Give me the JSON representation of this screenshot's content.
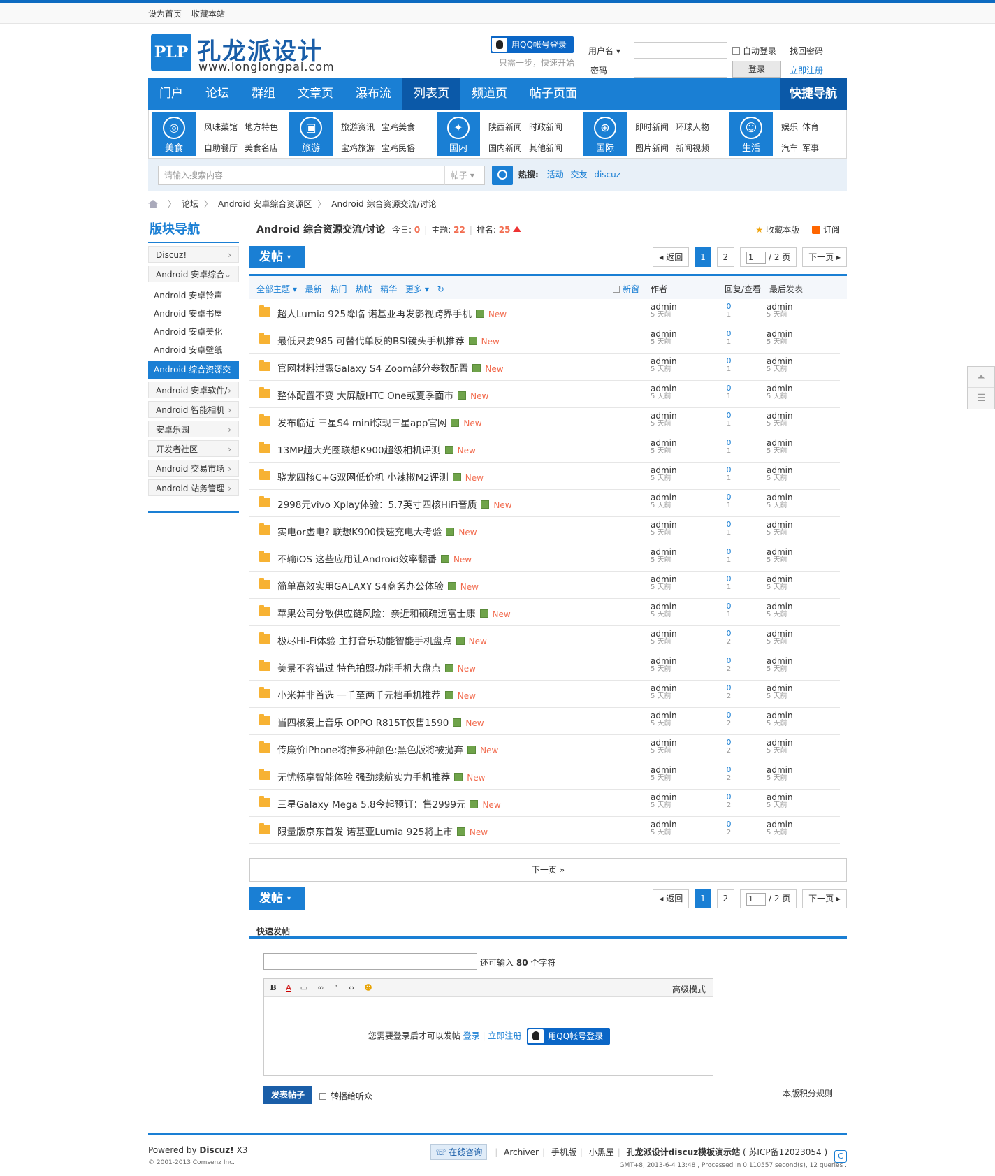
{
  "topbar": {
    "links": [
      "设为首页",
      "收藏本站"
    ]
  },
  "logo": {
    "mark": "PLP",
    "cn": "孔龙派设计",
    "url": "www.longlongpai.com"
  },
  "qq": {
    "btn": "用QQ帐号登录",
    "sub": "只需一步，快速开始"
  },
  "login": {
    "user_label": "用户名",
    "pass_label": "密码",
    "auto": "自动登录",
    "find": "找回密码",
    "register": "立即注册",
    "login_btn": "登录"
  },
  "nav": {
    "items": [
      "门户",
      "论坛",
      "群组",
      "文章页",
      "瀑布流",
      "列表页",
      "频道页",
      "帖子页面"
    ],
    "active": 5,
    "quick": "快捷导航"
  },
  "cats": [
    {
      "title": "美食",
      "links": [
        "风味菜馆",
        "地方特色",
        "自助餐厅",
        "美食名店"
      ]
    },
    {
      "title": "旅游",
      "links": [
        "旅游资讯",
        "宝鸡美食",
        "宝鸡旅游",
        "宝鸡民俗"
      ]
    },
    {
      "title": "国内",
      "links": [
        "陕西新闻",
        "时政新闻",
        "国内新闻",
        "其他新闻"
      ]
    },
    {
      "title": "国际",
      "links": [
        "即时新闻",
        "环球人物",
        "图片新闻",
        "新闻视频"
      ]
    },
    {
      "title": "生活",
      "links": [
        "娱乐",
        "体育",
        "汽车",
        "军事"
      ]
    }
  ],
  "search": {
    "placeholder": "请输入搜索内容",
    "type": "帖子",
    "hot_label": "热搜:",
    "hot": [
      "活动",
      "交友",
      "discuz"
    ]
  },
  "crumb": [
    "论坛",
    "Android 安卓综合资源区",
    "Android 综合资源交流/讨论"
  ],
  "side": {
    "title": "版块导航",
    "items": [
      "Discuz!",
      "Android 安卓综合"
    ],
    "subs": [
      "Android 安卓铃声",
      "Android 安卓书屋",
      "Android 安卓美化",
      "Android 安卓壁纸"
    ],
    "current": "Android 综合资源交",
    "items2": [
      "Android 安卓软件/",
      "Android 智能相机",
      "安卓乐园",
      "开发者社区",
      "Android 交易市场",
      "Android 站务管理"
    ]
  },
  "forum": {
    "name": "Android 综合资源交流/讨论",
    "today_label": "今日:",
    "today": "0",
    "topics_label": "主题:",
    "topics": "22",
    "rank_label": "排名:",
    "rank": "25",
    "fav": "收藏本版",
    "sub": "订阅"
  },
  "toolbar": {
    "post": "发帖",
    "back": "返回",
    "pages": [
      "1",
      "2"
    ],
    "page_input": "1",
    "total": "/ 2 页",
    "next": "下一页"
  },
  "listhead": {
    "tabs": [
      "全部主题 ▾",
      "最新",
      "热门",
      "热帖",
      "精华",
      "更多 ▾",
      "↻"
    ],
    "new": "新窗",
    "author": "作者",
    "replies": "回复/查看",
    "last": "最后发表"
  },
  "threads": [
    {
      "title": "超人Lumia 925降临 诺基亚再发影视跨界手机",
      "r": "0",
      "v": "1"
    },
    {
      "title": "最低只要985 可替代单反的BSI镜头手机推荐",
      "r": "0",
      "v": "1"
    },
    {
      "title": "官网材料泄露Galaxy S4 Zoom部分参数配置",
      "r": "0",
      "v": "1"
    },
    {
      "title": "整体配置不变 大屏版HTC One或夏季面市",
      "r": "0",
      "v": "1"
    },
    {
      "title": "发布临近 三星S4 mini惊现三星app官网",
      "r": "0",
      "v": "1"
    },
    {
      "title": "13MP超大光圈联想K900超级相机评测",
      "r": "0",
      "v": "1"
    },
    {
      "title": "骁龙四核C+G双网低价机 小辣椒M2评测",
      "r": "0",
      "v": "1"
    },
    {
      "title": "2998元vivo Xplay体验：5.7英寸四核HiFi音质",
      "r": "0",
      "v": "1"
    },
    {
      "title": "实电or虚电? 联想K900快速充电大考验",
      "r": "0",
      "v": "1"
    },
    {
      "title": "不输iOS 这些应用让Android效率翻番",
      "r": "0",
      "v": "1"
    },
    {
      "title": "简单高效实用GALAXY S4商务办公体验",
      "r": "0",
      "v": "1"
    },
    {
      "title": "苹果公司分散供应链风险：亲近和硕疏远富士康",
      "r": "0",
      "v": "1"
    },
    {
      "title": "极尽Hi-Fi体验 主打音乐功能智能手机盘点",
      "r": "0",
      "v": "2"
    },
    {
      "title": "美景不容错过 特色拍照功能手机大盘点",
      "r": "0",
      "v": "2"
    },
    {
      "title": "小米并非首选 一千至两千元档手机推荐",
      "r": "0",
      "v": "2"
    },
    {
      "title": "当四核爱上音乐 OPPO R815T仅售1590",
      "r": "0",
      "v": "2"
    },
    {
      "title": "传廉价iPhone将推多种颜色:黑色版将被抛弃",
      "r": "0",
      "v": "2"
    },
    {
      "title": "无忧畅享智能体验 强劲续航实力手机推荐",
      "r": "0",
      "v": "2"
    },
    {
      "title": "三星Galaxy Mega 5.8今起预订：售2999元",
      "r": "0",
      "v": "2"
    },
    {
      "title": "限量版京东首发 诺基亚Lumia 925将上市",
      "r": "0",
      "v": "2"
    }
  ],
  "thread_common": {
    "author": "admin",
    "time": "5 天前",
    "new": "New"
  },
  "nextbar": "下一页 »",
  "quick": {
    "title": "快速发帖",
    "remain": "还可输入",
    "remain_num": "80",
    "remain_unit": "个字符",
    "adv": "高级模式",
    "need_login": "您需要登录后才可以发帖",
    "login": "登录",
    "register": "立即注册",
    "submit": "发表帖子",
    "rebroadcast": "转播给听众",
    "rules": "本版积分规则"
  },
  "footer": {
    "powered": "Powered by",
    "brand": "Discuz!",
    "ver": "X3",
    "copy": "© 2001-2013 Comsenz Inc.",
    "consult": "在线咨询",
    "links": [
      "Archiver",
      "手机版",
      "小黑屋"
    ],
    "site": "孔龙派设计discuz模板演示站",
    "icp": "( 苏ICP备12023054 )",
    "info": "GMT+8, 2013-6-4 13:48 , Processed in 0.110557 second(s), 12 queries ."
  }
}
